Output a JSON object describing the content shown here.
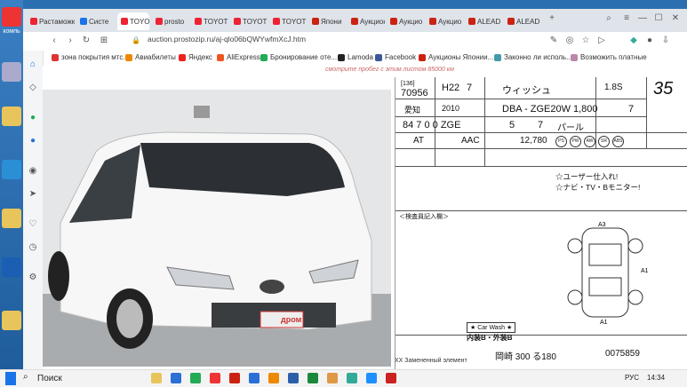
{
  "browser": {
    "tabs": [
      {
        "label": "Растаможк",
        "color": "#e23"
      },
      {
        "label": "Систе",
        "color": "#1a73e8"
      },
      {
        "label": "TOYOT",
        "color": "#e23"
      },
      {
        "label": "prosto",
        "color": "#e23"
      },
      {
        "label": "TOYOT",
        "color": "#e23"
      },
      {
        "label": "TOYOT",
        "color": "#e23"
      },
      {
        "label": "TOYOT",
        "color": "#e23"
      },
      {
        "label": "Япони",
        "color": "#c21"
      },
      {
        "label": "Аукцион",
        "color": "#c21"
      },
      {
        "label": "Аукцио",
        "color": "#c21"
      },
      {
        "label": "Аукцио",
        "color": "#c21"
      },
      {
        "label": "ALEAD",
        "color": "#c21"
      },
      {
        "label": "ALEAD",
        "color": "#c21"
      }
    ],
    "address": "auction.prostozip.ru/aj-qlo06bQWYwfmXcJ.htm",
    "bookmarks": [
      {
        "label": "зона покрытия мтс...",
        "color": "#d33"
      },
      {
        "label": "Авиабилеты",
        "color": "#e80"
      },
      {
        "label": "Яндекс",
        "color": "#e22"
      },
      {
        "label": "AliExpress",
        "color": "#e52"
      },
      {
        "label": "Бронирование оте...",
        "color": "#2a5"
      },
      {
        "label": "Lamoda",
        "color": "#222"
      },
      {
        "label": "Facebook",
        "color": "#3b5998"
      },
      {
        "label": "Аукционы Японии...",
        "color": "#c21"
      },
      {
        "label": "Законно ли исполь...",
        "color": "#49a"
      },
      {
        "label": "Возможить платные",
        "color": "#b8a"
      }
    ]
  },
  "page": {
    "promo": "смотрите пробег с этим листом 85000 км",
    "watermark": "дром",
    "sheet": {
      "lot": "70956",
      "reg": "[136]",
      "year_code": "H22",
      "year_num": "7",
      "model": "ウィッシュ",
      "engine": "1.8S",
      "region": "愛知",
      "year": "2010",
      "chassis": "DBA - ZGE20W",
      "displacement": "1,800",
      "score": "7",
      "doors": "5",
      "seats": "7",
      "color": "パール",
      "plate": "84 7 0 0 ZGE",
      "trans": "AT",
      "ac": "AAC",
      "mileage": "12,780",
      "grade_note": "☆ユーザー仕入れ!",
      "nav_note": "☆ナビ・TV・Bモニター!",
      "inspect_label": "＜検査員記入欄＞",
      "carwash": "★ Car Wash ★",
      "grade_b": "内装B・外装B",
      "stock": "0075859",
      "plate_region": "岡崎 300 る180",
      "num35": "35",
      "note": "XX Замененный элемент"
    }
  },
  "taskbar": {
    "search": "Поиск",
    "lang": "РУС",
    "time": "14:34"
  }
}
